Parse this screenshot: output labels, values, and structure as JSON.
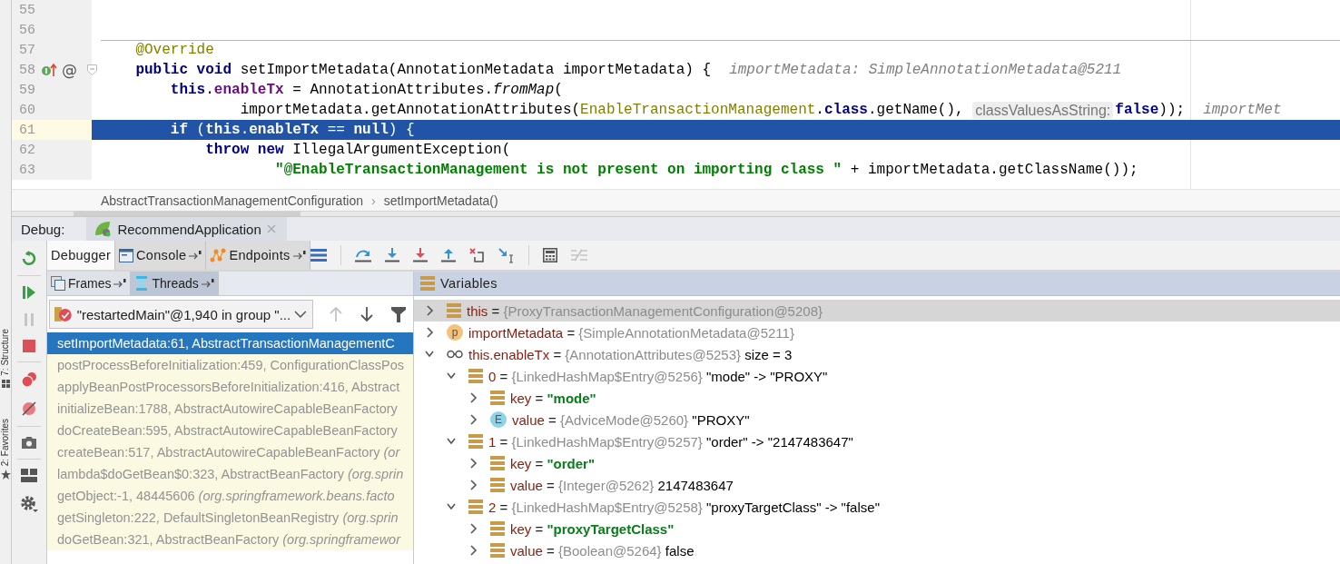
{
  "side_tabs": [
    {
      "label": "7: Structure"
    },
    {
      "label": "2: Favorites"
    }
  ],
  "editor": {
    "lines": [
      {
        "number": "55",
        "highlighted": false
      },
      {
        "number": "56",
        "highlighted": false
      },
      {
        "number": "57",
        "separator": true,
        "highlighted": false,
        "tokens": [
          {
            "text": "    @Override",
            "kind": "annotation"
          }
        ]
      },
      {
        "number": "58",
        "highlighted": false,
        "fold": true,
        "gutter": [
          {
            "kind": "implements"
          },
          {
            "kind": "glyph",
            "text": "@"
          }
        ],
        "tokens": [
          {
            "text": "    public void",
            "kind": "keyword"
          },
          {
            "text": " setImportMetadata(AnnotationMetadata importMetadata) {",
            "kind": "plain"
          },
          {
            "text": "importMetadata: SimpleAnnotationMetadata@5211",
            "kind": "hint"
          }
        ]
      },
      {
        "number": "59",
        "highlighted": false,
        "tokens": [
          {
            "text": "        this",
            "kind": "keyword"
          },
          {
            "text": ".",
            "kind": "plain"
          },
          {
            "text": "enableTx",
            "kind": "field"
          },
          {
            "text": " = AnnotationAttributes.",
            "kind": "plain"
          },
          {
            "text": "fromMap",
            "kind": "static"
          },
          {
            "text": "(",
            "kind": "plain"
          }
        ]
      },
      {
        "number": "60",
        "highlighted": false,
        "tokens": [
          {
            "text": "                importMetadata.getAnnotationAttributes(",
            "kind": "plain"
          },
          {
            "text": "EnableTransactionManagement",
            "kind": "annotation"
          },
          {
            "text": ".",
            "kind": "plain"
          },
          {
            "text": "class",
            "kind": "keyword"
          },
          {
            "text": ".getName(), ",
            "kind": "plain"
          },
          {
            "text": "classValuesAsString:",
            "kind": "param_hint"
          },
          {
            "text": "false",
            "kind": "keyword"
          },
          {
            "text": "));",
            "kind": "plain"
          },
          {
            "text": "importMet",
            "kind": "hint"
          }
        ]
      },
      {
        "number": "61",
        "highlighted": true,
        "tokens": [
          {
            "text": "        if",
            "kind": "keyword"
          },
          {
            "text": " (",
            "kind": "plain"
          },
          {
            "text": "this",
            "kind": "keyword"
          },
          {
            "text": ".",
            "kind": "plain"
          },
          {
            "text": "enableTx",
            "kind": "field"
          },
          {
            "text": " == ",
            "kind": "plain"
          },
          {
            "text": "null",
            "kind": "keyword"
          },
          {
            "text": ") {",
            "kind": "plain"
          }
        ]
      },
      {
        "number": "62",
        "highlighted": false,
        "tokens": [
          {
            "text": "            throw new",
            "kind": "keyword"
          },
          {
            "text": " IllegalArgumentException(",
            "kind": "plain"
          }
        ]
      },
      {
        "number": "63",
        "highlighted": false,
        "tokens": [
          {
            "text": "                    \"@EnableTransactionManagement is not present on importing class \"",
            "kind": "string"
          },
          {
            "text": " + importMetadata.getClassName());",
            "kind": "plain"
          }
        ]
      }
    ]
  },
  "breadcrumbs": [
    {
      "label": "AbstractTransactionManagementConfiguration"
    },
    {
      "label": "setImportMetadata()"
    }
  ],
  "breadcrumb_separator": "›",
  "debug": {
    "label": "Debug:",
    "tabs": [
      {
        "label": "RecommendApplication",
        "selected": true
      }
    ]
  },
  "debug_tabs": [
    {
      "label": "Debugger",
      "kind": "plain",
      "selected": true
    },
    {
      "label": "Console",
      "kind": "console",
      "selected": false
    },
    {
      "label": "Endpoints",
      "kind": "endpoints",
      "selected": false
    }
  ],
  "frames": {
    "tabs": [
      {
        "label": "Frames",
        "kind": "frames",
        "selected": true
      },
      {
        "label": "Threads",
        "kind": "threads",
        "selected": false
      }
    ],
    "thread": "\"restartedMain\"@1,940 in group \"...",
    "rows": [
      {
        "text": "setImportMetadata:61, AbstractTransactionManagementC",
        "selected": true
      },
      {
        "text": "postProcessBeforeInitialization:459, ConfigurationClassPos",
        "selected": false
      },
      {
        "text": "applyBeanPostProcessorsBeforeInitialization:416, Abstract",
        "selected": false
      },
      {
        "text": "initializeBean:1788, AbstractAutowireCapableBeanFactory",
        "selected": false
      },
      {
        "text": "doCreateBean:595, AbstractAutowireCapableBeanFactory",
        "selected": false
      },
      {
        "text": "createBean:517, AbstractAutowireCapableBeanFactory *(or*",
        "selected": false
      },
      {
        "text": "lambda$doGetBean$0:323, AbstractBeanFactory *(org.sprin*",
        "selected": false
      },
      {
        "text": "getObject:-1, 48445606 *(org.springframework.beans.facto*",
        "selected": false
      },
      {
        "text": "getSingleton:222, DefaultSingletonBeanRegistry *(org.sprin*",
        "selected": false
      },
      {
        "text": "doGetBean:321, AbstractBeanFactory *(org.springframewor*",
        "selected": false
      }
    ]
  },
  "variables": {
    "title": "Variables",
    "items": [
      {
        "kind": "field",
        "name": "this",
        "op": "=",
        "ref": "{ProxyTransactionManagementConfiguration@5208}",
        "expanded": false,
        "selected": true
      },
      {
        "kind": "param",
        "badge": "p",
        "name": "importMetadata",
        "op": "=",
        "ref": "{SimpleAnnotationMetadata@5211}",
        "expanded": false,
        "selected": false
      },
      {
        "kind": "watch",
        "name": "this.enableTx",
        "op": "=",
        "ref": "{AnnotationAttributes@5253}",
        "value": "size = 3",
        "expanded": true,
        "selected": false,
        "children": [
          {
            "kind": "field",
            "name": "0",
            "op": "=",
            "ref": "{LinkedHashMap$Entry@5256}",
            "value": "\"mode\" -> \"PROXY\"",
            "expanded": true,
            "selected": false,
            "children": [
              {
                "kind": "field",
                "name": "key",
                "op": "=",
                "string": "\"mode\"",
                "expanded": false,
                "selected": false
              },
              {
                "kind": "enum",
                "badge": "E",
                "name": "value",
                "op": "=",
                "ref": "{AdviceMode@5260}",
                "value": "\"PROXY\"",
                "expanded": false,
                "selected": false
              }
            ]
          },
          {
            "kind": "field",
            "name": "1",
            "op": "=",
            "ref": "{LinkedHashMap$Entry@5257}",
            "value": "\"order\" -> \"2147483647\"",
            "expanded": true,
            "selected": false,
            "children": [
              {
                "kind": "field",
                "name": "key",
                "op": "=",
                "string": "\"order\"",
                "expanded": false,
                "selected": false
              },
              {
                "kind": "field",
                "name": "value",
                "op": "=",
                "ref": "{Integer@5262}",
                "value": "2147483647",
                "expanded": false,
                "selected": false
              }
            ]
          },
          {
            "kind": "field",
            "name": "2",
            "op": "=",
            "ref": "{LinkedHashMap$Entry@5258}",
            "value": "\"proxyTargetClass\" -> \"false\"",
            "expanded": true,
            "selected": false,
            "children": [
              {
                "kind": "field",
                "name": "key",
                "op": "=",
                "string": "\"proxyTargetClass\"",
                "expanded": false,
                "selected": false
              },
              {
                "kind": "field",
                "name": "value",
                "op": "=",
                "ref": "{Boolean@5264}",
                "value": "false",
                "expanded": false,
                "selected": false
              }
            ]
          }
        ]
      }
    ]
  }
}
